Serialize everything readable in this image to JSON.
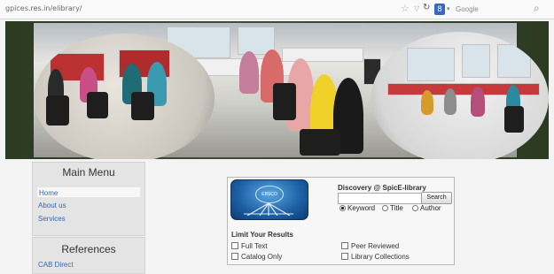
{
  "browser": {
    "url": "gpices.res.in/elibrary/",
    "search_engine": "Google"
  },
  "main_menu": {
    "title": "Main Menu",
    "items": [
      {
        "label": "Home"
      },
      {
        "label": "About us"
      },
      {
        "label": "Services"
      }
    ]
  },
  "references": {
    "title": "References",
    "items": [
      {
        "label": "CAB Direct"
      }
    ]
  },
  "discovery": {
    "logo_text": "EBSCO",
    "title": "Discovery @ SpicE-library",
    "search_button": "Search",
    "search_value": "",
    "options": [
      {
        "label": "Keyword",
        "selected": true
      },
      {
        "label": "Title",
        "selected": false
      },
      {
        "label": "Author",
        "selected": false
      }
    ],
    "limit_title": "Limit Your Results",
    "limits": [
      {
        "label": "Full Text"
      },
      {
        "label": "Peer Reviewed"
      },
      {
        "label": "Catalog Only"
      },
      {
        "label": "Library Collections"
      }
    ]
  }
}
